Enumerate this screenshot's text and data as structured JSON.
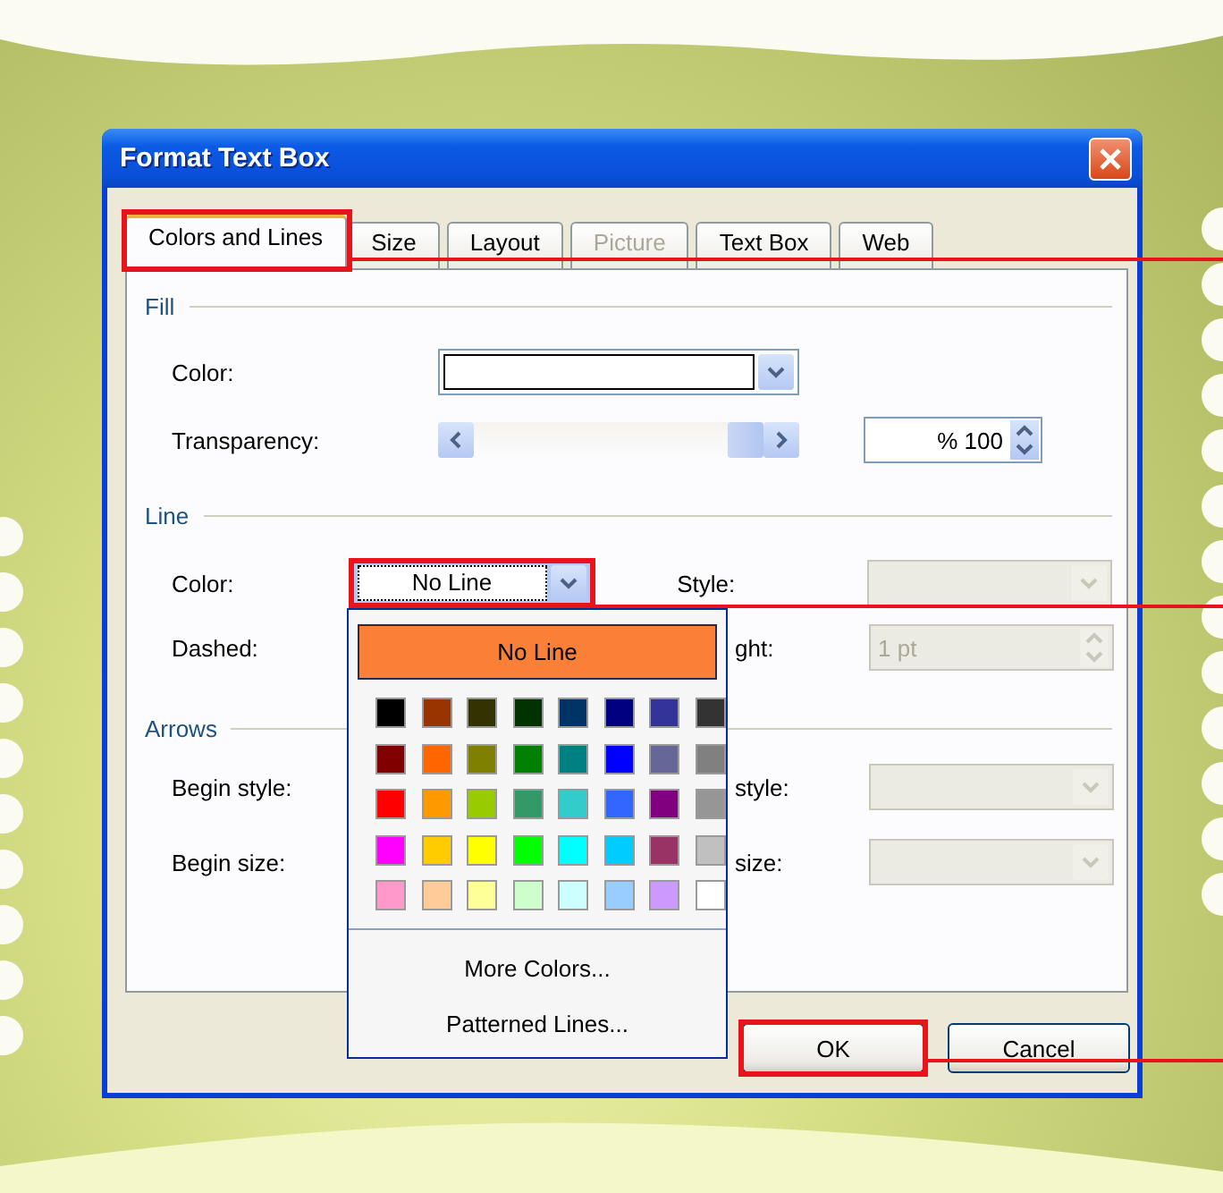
{
  "window": {
    "title": "Format Text Box"
  },
  "tabs": [
    {
      "label": "Colors and Lines",
      "selected": true,
      "disabled": false,
      "highlighted": true
    },
    {
      "label": "Size",
      "selected": false,
      "disabled": false,
      "highlighted": false
    },
    {
      "label": "Layout",
      "selected": false,
      "disabled": false,
      "highlighted": false
    },
    {
      "label": "Picture",
      "selected": false,
      "disabled": true,
      "highlighted": false
    },
    {
      "label": "Text Box",
      "selected": false,
      "disabled": false,
      "highlighted": false
    },
    {
      "label": "Web",
      "selected": false,
      "disabled": false,
      "highlighted": false
    }
  ],
  "fill": {
    "header": "Fill",
    "color": {
      "label": "Color:"
    },
    "transparency": {
      "label": "Transparency:",
      "level": 1,
      "value": "% 100"
    }
  },
  "line": {
    "header": "Line",
    "color": {
      "label": "Color:",
      "value": "No Line",
      "expanded": true,
      "highlighted": true
    },
    "style": {
      "label": "Style:",
      "disabled": true
    },
    "dashed": {
      "label": "Dashed:"
    },
    "weight": {
      "label": "ght:",
      "value": "1 pt",
      "disabled": true
    }
  },
  "arrows": {
    "header": "Arrows",
    "begin_style": {
      "label": "Begin style:"
    },
    "end_style": {
      "label": "style:",
      "disabled": true
    },
    "begin_size": {
      "label": "Begin size:"
    },
    "end_size": {
      "label": "size:",
      "disabled": true
    }
  },
  "color_menu": {
    "no_line": {
      "label": "No Line",
      "selected": true
    },
    "swatches": [
      [
        {
          "color": "#000000",
          "selected": false
        },
        {
          "color": "#993300",
          "selected": false
        },
        {
          "color": "#333300",
          "selected": false
        },
        {
          "color": "#003300",
          "selected": false
        },
        {
          "color": "#003366",
          "selected": false
        },
        {
          "color": "#000080",
          "selected": false
        },
        {
          "color": "#333399",
          "selected": false
        },
        {
          "color": "#333333",
          "selected": false
        }
      ],
      [
        {
          "color": "#800000",
          "selected": false
        },
        {
          "color": "#ff6600",
          "selected": false
        },
        {
          "color": "#808000",
          "selected": false
        },
        {
          "color": "#008000",
          "selected": false
        },
        {
          "color": "#008080",
          "selected": false
        },
        {
          "color": "#0000ff",
          "selected": false
        },
        {
          "color": "#666699",
          "selected": false
        },
        {
          "color": "#808080",
          "selected": false
        }
      ],
      [
        {
          "color": "#ff0000",
          "selected": false
        },
        {
          "color": "#ff9900",
          "selected": false
        },
        {
          "color": "#99cc00",
          "selected": false
        },
        {
          "color": "#339966",
          "selected": false
        },
        {
          "color": "#33cccc",
          "selected": false
        },
        {
          "color": "#3366ff",
          "selected": false
        },
        {
          "color": "#800080",
          "selected": false
        },
        {
          "color": "#969696",
          "selected": false
        }
      ],
      [
        {
          "color": "#ff00ff",
          "selected": false
        },
        {
          "color": "#ffcc00",
          "selected": false
        },
        {
          "color": "#ffff00",
          "selected": false
        },
        {
          "color": "#00ff00",
          "selected": false
        },
        {
          "color": "#00ffff",
          "selected": false
        },
        {
          "color": "#00ccff",
          "selected": false
        },
        {
          "color": "#993366",
          "selected": false
        },
        {
          "color": "#c0c0c0",
          "selected": false
        }
      ],
      [
        {
          "color": "#ff99cc",
          "selected": false
        },
        {
          "color": "#ffcc99",
          "selected": false
        },
        {
          "color": "#ffff99",
          "selected": false
        },
        {
          "color": "#ccffcc",
          "selected": false
        },
        {
          "color": "#ccffff",
          "selected": false
        },
        {
          "color": "#99ccff",
          "selected": false
        },
        {
          "color": "#cc99ff",
          "selected": false
        },
        {
          "color": "#ffffff",
          "selected": false
        }
      ]
    ],
    "items": [
      "More Colors...",
      "Patterned Lines..."
    ]
  },
  "buttons": [
    {
      "label": "OK",
      "highlighted": true
    },
    {
      "label": "Cancel",
      "highlighted": false
    }
  ]
}
